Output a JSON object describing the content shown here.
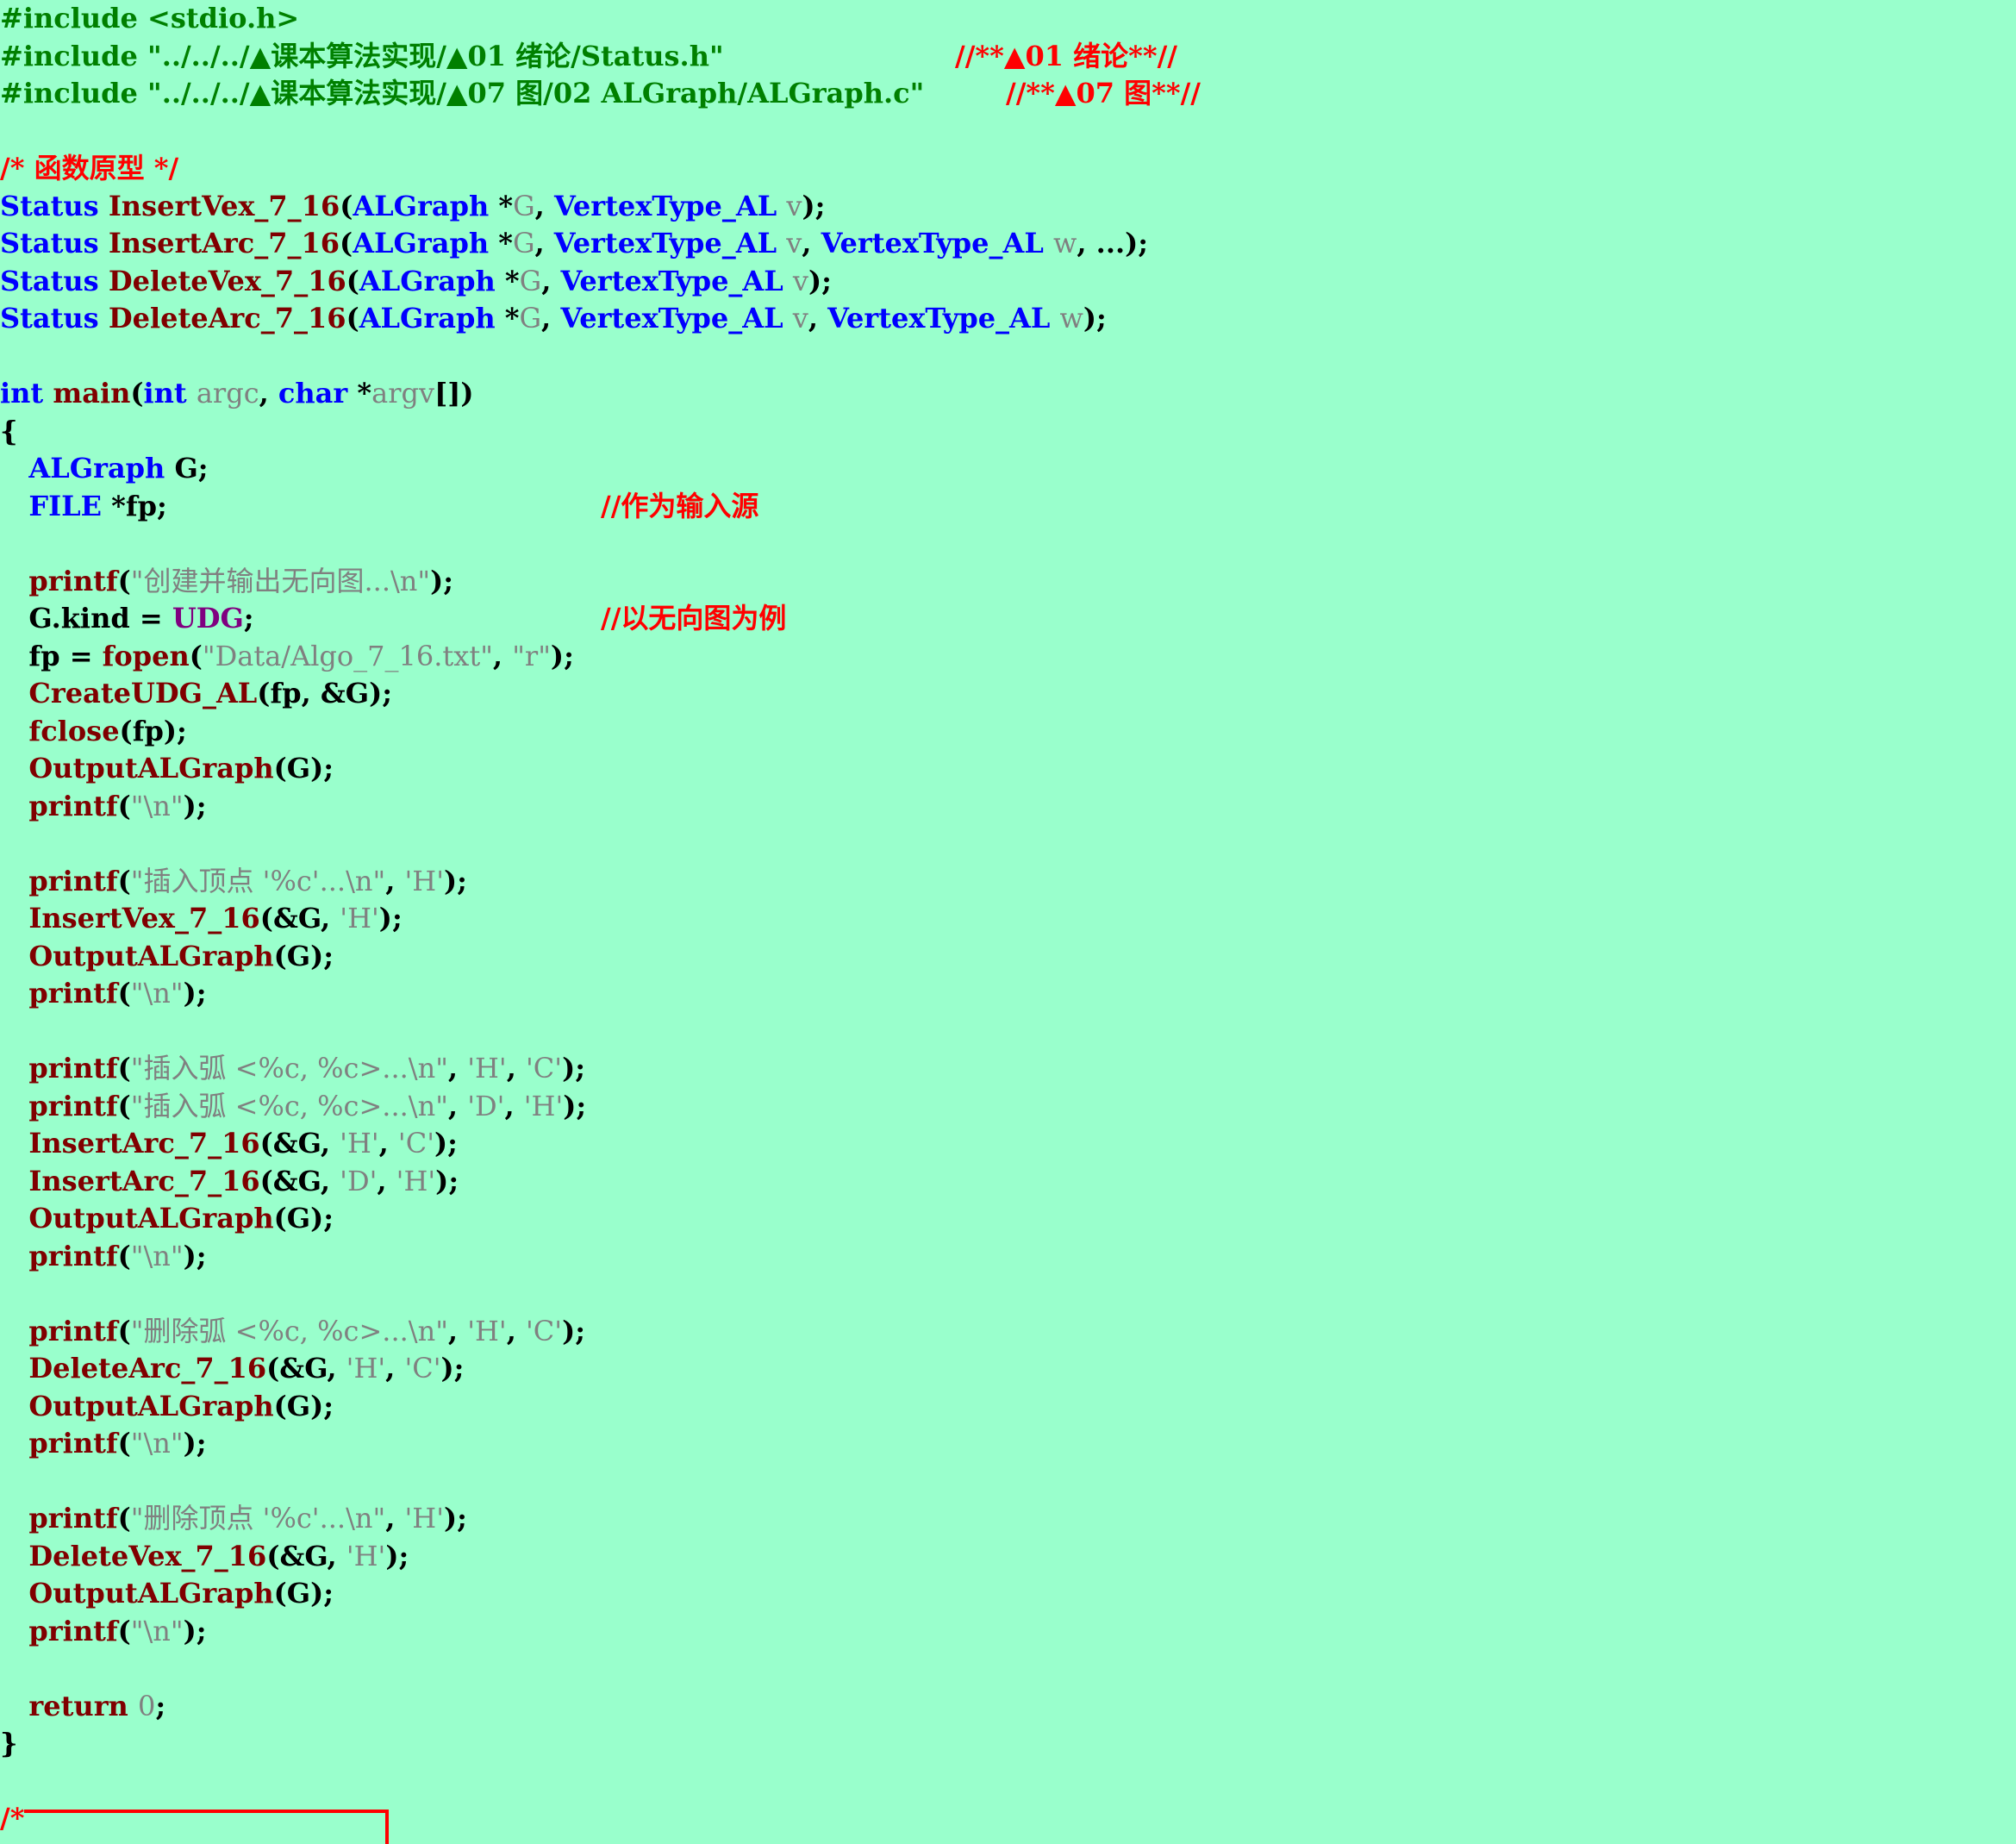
{
  "colors": {
    "background": "#99ffcc",
    "preprocessor": "#008000",
    "comment": "#ff0000",
    "keyword_type": "#0000ff",
    "function": "#800000",
    "plain": "#000000",
    "param_string_number": "#808080",
    "macro": "#800080"
  },
  "code": {
    "lines": [
      {
        "tokens": [
          {
            "c": "pre",
            "t": "#include <stdio.h>"
          }
        ]
      },
      {
        "tokens": [
          {
            "c": "pre",
            "t": "#include \"../../../▲课本算法实现/▲01 绪论/Status.h\""
          }
        ],
        "comment": "//**▲01 绪论**//"
      },
      {
        "tokens": [
          {
            "c": "pre",
            "t": "#include \"../../../▲课本算法实现/▲07 图/02 ALGraph/ALGraph.c\""
          }
        ],
        "comment": "//**▲07 图**//"
      },
      {
        "tokens": []
      },
      {
        "tokens": [
          {
            "c": "cmt",
            "t": "/* 函数原型 */"
          }
        ]
      },
      {
        "tokens": [
          {
            "c": "kw",
            "t": "Status "
          },
          {
            "c": "fn",
            "t": "InsertVex_7_16"
          },
          {
            "c": "plain",
            "t": "("
          },
          {
            "c": "kw",
            "t": "ALGraph "
          },
          {
            "c": "plain",
            "t": "*"
          },
          {
            "c": "param",
            "t": "G"
          },
          {
            "c": "plain",
            "t": ", "
          },
          {
            "c": "kw",
            "t": "VertexType_AL "
          },
          {
            "c": "param",
            "t": "v"
          },
          {
            "c": "plain",
            "t": ");"
          }
        ]
      },
      {
        "tokens": [
          {
            "c": "kw",
            "t": "Status "
          },
          {
            "c": "fn",
            "t": "InsertArc_7_16"
          },
          {
            "c": "plain",
            "t": "("
          },
          {
            "c": "kw",
            "t": "ALGraph "
          },
          {
            "c": "plain",
            "t": "*"
          },
          {
            "c": "param",
            "t": "G"
          },
          {
            "c": "plain",
            "t": ", "
          },
          {
            "c": "kw",
            "t": "VertexType_AL "
          },
          {
            "c": "param",
            "t": "v"
          },
          {
            "c": "plain",
            "t": ", "
          },
          {
            "c": "kw",
            "t": "VertexType_AL "
          },
          {
            "c": "param",
            "t": "w"
          },
          {
            "c": "plain",
            "t": ", ...);"
          }
        ]
      },
      {
        "tokens": [
          {
            "c": "kw",
            "t": "Status "
          },
          {
            "c": "fn",
            "t": "DeleteVex_7_16"
          },
          {
            "c": "plain",
            "t": "("
          },
          {
            "c": "kw",
            "t": "ALGraph "
          },
          {
            "c": "plain",
            "t": "*"
          },
          {
            "c": "param",
            "t": "G"
          },
          {
            "c": "plain",
            "t": ", "
          },
          {
            "c": "kw",
            "t": "VertexType_AL "
          },
          {
            "c": "param",
            "t": "v"
          },
          {
            "c": "plain",
            "t": ");"
          }
        ]
      },
      {
        "tokens": [
          {
            "c": "kw",
            "t": "Status "
          },
          {
            "c": "fn",
            "t": "DeleteArc_7_16"
          },
          {
            "c": "plain",
            "t": "("
          },
          {
            "c": "kw",
            "t": "ALGraph "
          },
          {
            "c": "plain",
            "t": "*"
          },
          {
            "c": "param",
            "t": "G"
          },
          {
            "c": "plain",
            "t": ", "
          },
          {
            "c": "kw",
            "t": "VertexType_AL "
          },
          {
            "c": "param",
            "t": "v"
          },
          {
            "c": "plain",
            "t": ", "
          },
          {
            "c": "kw",
            "t": "VertexType_AL "
          },
          {
            "c": "param",
            "t": "w"
          },
          {
            "c": "plain",
            "t": ");"
          }
        ]
      },
      {
        "tokens": []
      },
      {
        "tokens": [
          {
            "c": "kw",
            "t": "int "
          },
          {
            "c": "fn",
            "t": "main"
          },
          {
            "c": "plain",
            "t": "("
          },
          {
            "c": "kw",
            "t": "int "
          },
          {
            "c": "param",
            "t": "argc"
          },
          {
            "c": "plain",
            "t": ", "
          },
          {
            "c": "kw",
            "t": "char "
          },
          {
            "c": "plain",
            "t": "*"
          },
          {
            "c": "param",
            "t": "argv"
          },
          {
            "c": "plain",
            "t": "[])"
          }
        ]
      },
      {
        "tokens": [
          {
            "c": "plain",
            "t": "{"
          }
        ]
      },
      {
        "tokens": [
          {
            "c": "kw",
            "t": "   ALGraph "
          },
          {
            "c": "plain",
            "t": "G;"
          }
        ]
      },
      {
        "tokens": [
          {
            "c": "kw",
            "t": "   FILE "
          },
          {
            "c": "plain",
            "t": "*fp;"
          }
        ],
        "comment": "//作为输入源"
      },
      {
        "tokens": []
      },
      {
        "tokens": [
          {
            "c": "fn",
            "t": "   printf"
          },
          {
            "c": "plain",
            "t": "("
          },
          {
            "c": "str",
            "t": "\"创建并输出无向图...\\n\""
          },
          {
            "c": "plain",
            "t": ");"
          }
        ]
      },
      {
        "tokens": [
          {
            "c": "plain",
            "t": "   G.kind = "
          },
          {
            "c": "macro",
            "t": "UDG"
          },
          {
            "c": "plain",
            "t": ";"
          }
        ],
        "comment": "//以无向图为例"
      },
      {
        "tokens": [
          {
            "c": "plain",
            "t": "   fp = "
          },
          {
            "c": "fn",
            "t": "fopen"
          },
          {
            "c": "plain",
            "t": "("
          },
          {
            "c": "str",
            "t": "\"Data/Algo_7_16.txt\""
          },
          {
            "c": "plain",
            "t": ", "
          },
          {
            "c": "str",
            "t": "\"r\""
          },
          {
            "c": "plain",
            "t": ");"
          }
        ]
      },
      {
        "tokens": [
          {
            "c": "fn",
            "t": "   CreateUDG_AL"
          },
          {
            "c": "plain",
            "t": "(fp, &G);"
          }
        ]
      },
      {
        "tokens": [
          {
            "c": "fn",
            "t": "   fclose"
          },
          {
            "c": "plain",
            "t": "(fp);"
          }
        ]
      },
      {
        "tokens": [
          {
            "c": "fn",
            "t": "   OutputALGraph"
          },
          {
            "c": "plain",
            "t": "(G);"
          }
        ]
      },
      {
        "tokens": [
          {
            "c": "fn",
            "t": "   printf"
          },
          {
            "c": "plain",
            "t": "("
          },
          {
            "c": "str",
            "t": "\"\\n\""
          },
          {
            "c": "plain",
            "t": ");"
          }
        ]
      },
      {
        "tokens": []
      },
      {
        "tokens": [
          {
            "c": "fn",
            "t": "   printf"
          },
          {
            "c": "plain",
            "t": "("
          },
          {
            "c": "str",
            "t": "\"插入顶点 '%c'...\\n\""
          },
          {
            "c": "plain",
            "t": ", "
          },
          {
            "c": "str",
            "t": "'H'"
          },
          {
            "c": "plain",
            "t": ");"
          }
        ]
      },
      {
        "tokens": [
          {
            "c": "fn",
            "t": "   InsertVex_7_16"
          },
          {
            "c": "plain",
            "t": "(&G, "
          },
          {
            "c": "str",
            "t": "'H'"
          },
          {
            "c": "plain",
            "t": ");"
          }
        ]
      },
      {
        "tokens": [
          {
            "c": "fn",
            "t": "   OutputALGraph"
          },
          {
            "c": "plain",
            "t": "(G);"
          }
        ]
      },
      {
        "tokens": [
          {
            "c": "fn",
            "t": "   printf"
          },
          {
            "c": "plain",
            "t": "("
          },
          {
            "c": "str",
            "t": "\"\\n\""
          },
          {
            "c": "plain",
            "t": ");"
          }
        ]
      },
      {
        "tokens": []
      },
      {
        "tokens": [
          {
            "c": "fn",
            "t": "   printf"
          },
          {
            "c": "plain",
            "t": "("
          },
          {
            "c": "str",
            "t": "\"插入弧 <%c, %c>...\\n\""
          },
          {
            "c": "plain",
            "t": ", "
          },
          {
            "c": "str",
            "t": "'H'"
          },
          {
            "c": "plain",
            "t": ", "
          },
          {
            "c": "str",
            "t": "'C'"
          },
          {
            "c": "plain",
            "t": ");"
          }
        ]
      },
      {
        "tokens": [
          {
            "c": "fn",
            "t": "   printf"
          },
          {
            "c": "plain",
            "t": "("
          },
          {
            "c": "str",
            "t": "\"插入弧 <%c, %c>...\\n\""
          },
          {
            "c": "plain",
            "t": ", "
          },
          {
            "c": "str",
            "t": "'D'"
          },
          {
            "c": "plain",
            "t": ", "
          },
          {
            "c": "str",
            "t": "'H'"
          },
          {
            "c": "plain",
            "t": ");"
          }
        ]
      },
      {
        "tokens": [
          {
            "c": "fn",
            "t": "   InsertArc_7_16"
          },
          {
            "c": "plain",
            "t": "(&G, "
          },
          {
            "c": "str",
            "t": "'H'"
          },
          {
            "c": "plain",
            "t": ", "
          },
          {
            "c": "str",
            "t": "'C'"
          },
          {
            "c": "plain",
            "t": ");"
          }
        ]
      },
      {
        "tokens": [
          {
            "c": "fn",
            "t": "   InsertArc_7_16"
          },
          {
            "c": "plain",
            "t": "(&G, "
          },
          {
            "c": "str",
            "t": "'D'"
          },
          {
            "c": "plain",
            "t": ", "
          },
          {
            "c": "str",
            "t": "'H'"
          },
          {
            "c": "plain",
            "t": ");"
          }
        ]
      },
      {
        "tokens": [
          {
            "c": "fn",
            "t": "   OutputALGraph"
          },
          {
            "c": "plain",
            "t": "(G);"
          }
        ]
      },
      {
        "tokens": [
          {
            "c": "fn",
            "t": "   printf"
          },
          {
            "c": "plain",
            "t": "("
          },
          {
            "c": "str",
            "t": "\"\\n\""
          },
          {
            "c": "plain",
            "t": ");"
          }
        ]
      },
      {
        "tokens": []
      },
      {
        "tokens": [
          {
            "c": "fn",
            "t": "   printf"
          },
          {
            "c": "plain",
            "t": "("
          },
          {
            "c": "str",
            "t": "\"删除弧 <%c, %c>...\\n\""
          },
          {
            "c": "plain",
            "t": ", "
          },
          {
            "c": "str",
            "t": "'H'"
          },
          {
            "c": "plain",
            "t": ", "
          },
          {
            "c": "str",
            "t": "'C'"
          },
          {
            "c": "plain",
            "t": ");"
          }
        ]
      },
      {
        "tokens": [
          {
            "c": "fn",
            "t": "   DeleteArc_7_16"
          },
          {
            "c": "plain",
            "t": "(&G, "
          },
          {
            "c": "str",
            "t": "'H'"
          },
          {
            "c": "plain",
            "t": ", "
          },
          {
            "c": "str",
            "t": "'C'"
          },
          {
            "c": "plain",
            "t": ");"
          }
        ]
      },
      {
        "tokens": [
          {
            "c": "fn",
            "t": "   OutputALGraph"
          },
          {
            "c": "plain",
            "t": "(G);"
          }
        ]
      },
      {
        "tokens": [
          {
            "c": "fn",
            "t": "   printf"
          },
          {
            "c": "plain",
            "t": "("
          },
          {
            "c": "str",
            "t": "\"\\n\""
          },
          {
            "c": "plain",
            "t": ");"
          }
        ]
      },
      {
        "tokens": []
      },
      {
        "tokens": [
          {
            "c": "fn",
            "t": "   printf"
          },
          {
            "c": "plain",
            "t": "("
          },
          {
            "c": "str",
            "t": "\"删除顶点 '%c'...\\n\""
          },
          {
            "c": "plain",
            "t": ", "
          },
          {
            "c": "str",
            "t": "'H'"
          },
          {
            "c": "plain",
            "t": ");"
          }
        ]
      },
      {
        "tokens": [
          {
            "c": "fn",
            "t": "   DeleteVex_7_16"
          },
          {
            "c": "plain",
            "t": "(&G, "
          },
          {
            "c": "str",
            "t": "'H'"
          },
          {
            "c": "plain",
            "t": ");"
          }
        ]
      },
      {
        "tokens": [
          {
            "c": "fn",
            "t": "   OutputALGraph"
          },
          {
            "c": "plain",
            "t": "(G);"
          }
        ]
      },
      {
        "tokens": [
          {
            "c": "fn",
            "t": "   printf"
          },
          {
            "c": "plain",
            "t": "("
          },
          {
            "c": "str",
            "t": "\"\\n\""
          },
          {
            "c": "plain",
            "t": ");"
          }
        ]
      },
      {
        "tokens": []
      },
      {
        "tokens": [
          {
            "c": "fn",
            "t": "   return "
          },
          {
            "c": "num",
            "t": "0"
          },
          {
            "c": "plain",
            "t": ";"
          }
        ]
      },
      {
        "tokens": [
          {
            "c": "plain",
            "t": "}"
          }
        ]
      },
      {
        "tokens": []
      },
      {
        "tokens": [
          {
            "c": "cmt",
            "t": "/*"
          }
        ]
      }
    ]
  }
}
